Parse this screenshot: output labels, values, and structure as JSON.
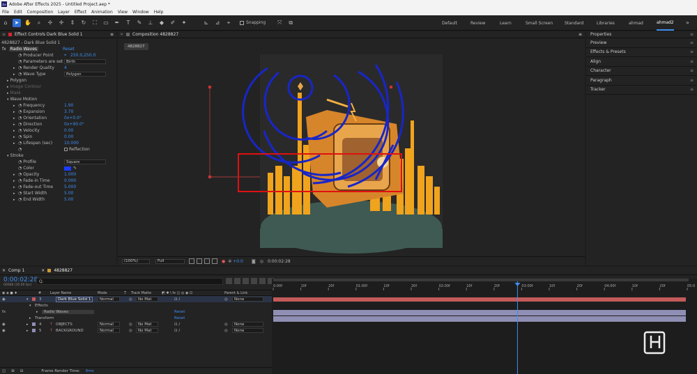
{
  "titlebar": {
    "title": "Adobe After Effects 2025 - Untitled Project.aep *",
    "logo": "Ae"
  },
  "menu": [
    "File",
    "Edit",
    "Composition",
    "Layer",
    "Effect",
    "Animation",
    "View",
    "Window",
    "Help"
  ],
  "toolbar": {
    "snapping": "Snapping"
  },
  "workspaces": [
    "Default",
    "Review",
    "Learn",
    "Small Screen",
    "Standard",
    "Libraries",
    "ahmad",
    "ahmad2"
  ],
  "effect_controls": {
    "tab": "Effect Controls Dark Blue Solid 1",
    "layer": "4828827 - Dark Blue Solid 1",
    "effect": "Radio Waves",
    "reset": "Reset",
    "producer_point": {
      "label": "Producer Point",
      "value": "250.0,250.0"
    },
    "params_set_at": {
      "label": "Parameters are set at",
      "value": "Birth"
    },
    "render_quality": {
      "label": "Render Quality",
      "value": "4"
    },
    "wave_type": {
      "label": "Wave Type",
      "value": "Polygon"
    },
    "polygon": "Polygon",
    "image_contour": "Image Contour",
    "mask": "Mask",
    "wave_motion": "Wave Motion",
    "frequency": {
      "label": "Frequency",
      "value": "1.90"
    },
    "expansion": {
      "label": "Expansion",
      "value": "3.70"
    },
    "orientation": {
      "label": "Orientation",
      "value": "0x+0.0°"
    },
    "direction": {
      "label": "Direction",
      "value": "0x+90.0°"
    },
    "velocity": {
      "label": "Velocity",
      "value": "0.00"
    },
    "spin": {
      "label": "Spin",
      "value": "0.00"
    },
    "lifespan": {
      "label": "Lifespan (sec)",
      "value": "10.000"
    },
    "reflection": "Reflection",
    "stroke": "Stroke",
    "profile": {
      "label": "Profile",
      "value": "Square"
    },
    "color": {
      "label": "Color",
      "swatch": "#1a3cff"
    },
    "opacity": {
      "label": "Opacity",
      "value": "1.000"
    },
    "fade_in": {
      "label": "Fade-in Time",
      "value": "0.000"
    },
    "fade_out": {
      "label": "Fade-out Time",
      "value": "5.000"
    },
    "start_width": {
      "label": "Start Width",
      "value": "5.00"
    },
    "end_width": {
      "label": "End Width",
      "value": "5.00"
    }
  },
  "composition": {
    "tab": "Composition 4828827",
    "chip": "4828827",
    "zoom": "(100%)",
    "resolution": "Full",
    "exposure": "+0.0",
    "timecode": "0:00:02:28"
  },
  "right_panel": [
    "Properties",
    "Preview",
    "Effects & Presets",
    "Align",
    "Character",
    "Paragraph",
    "Tracker"
  ],
  "timeline": {
    "tabs": [
      "Comp 1",
      "4828827"
    ],
    "timecode": "0:00:02:28",
    "fps": "00088 (30.00 fps)",
    "search_placeholder": "Q.",
    "headers": {
      "layer_name": "Layer Name",
      "mode": "Mode",
      "t": "T",
      "track_matte": "Track Matte",
      "parent": "Parent & Link"
    },
    "ruler": [
      "0:00f",
      "10f",
      "20f",
      "01:00f",
      "10f",
      "20f",
      "02:00f",
      "10f",
      "20f",
      "03:00f",
      "10f",
      "20f",
      "04:00f",
      "10f",
      "20f",
      "05:0"
    ],
    "playhead_fraction": 0.59,
    "layers": [
      {
        "num": "3",
        "name": "Dark Blue Solid 1",
        "mode": "Normal",
        "matte": "No Mat",
        "parent": "None",
        "bar": "#c35a5a"
      },
      {
        "num": "4",
        "name": "OBJECTS",
        "mode": "Normal",
        "matte": "No Mat",
        "parent": "None",
        "bar": "#8f8fb5"
      },
      {
        "num": "5",
        "name": "BACKGROUND",
        "mode": "Normal",
        "matte": "No Mat",
        "parent": "None",
        "bar": "#8f8fb5"
      }
    ],
    "effects": "Effects",
    "radio_waves": "Radio Waves",
    "transform": "Transform",
    "reset": "Reset",
    "status": "Frame Render Time:",
    "render_time": "6ms"
  },
  "colors": {
    "accent": "#3f8ef0",
    "red_box": "#e01010",
    "wave": "#1826c8",
    "ground": "#3f5a52"
  }
}
